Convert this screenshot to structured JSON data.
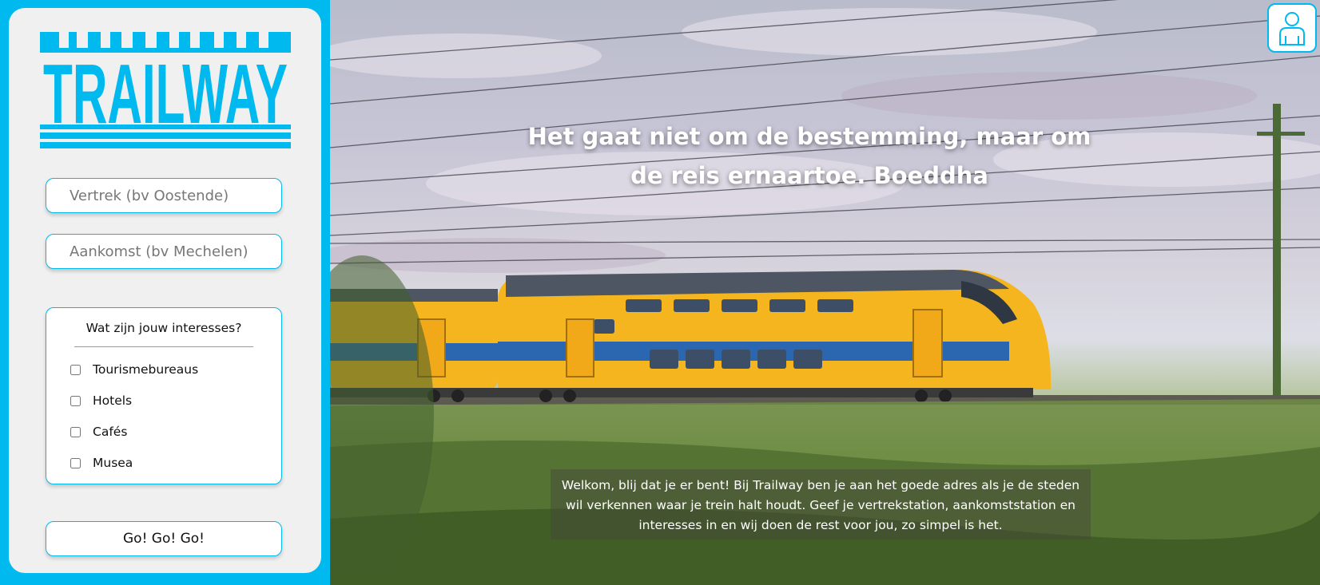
{
  "brand": {
    "logo_text": "TRAILWAY",
    "accent_color": "#00b9ee"
  },
  "search": {
    "departure_placeholder": "Vertrek (bv Oostende)",
    "arrival_placeholder": "Aankomst (bv Mechelen)"
  },
  "interests": {
    "title": "Wat zijn jouw interesses?",
    "options": [
      "Tourismebureaus",
      "Hotels",
      "Cafés",
      "Musea"
    ]
  },
  "actions": {
    "go_label": "Go! Go! Go!"
  },
  "hero": {
    "quote": "Het gaat niet om de bestemming, maar om de reis ernaartoe. Boeddha",
    "welcome": "Welkom, blij dat je er bent! Bij Trailway ben je aan het goede adres als je de steden wil verkennen waar je trein halt houdt. Geef je vertrekstation, aankomststation en interesses in en wij doen de rest voor jou, zo simpel is het."
  },
  "icons": {
    "profile": "user-icon",
    "logo": "trailway-logo"
  }
}
